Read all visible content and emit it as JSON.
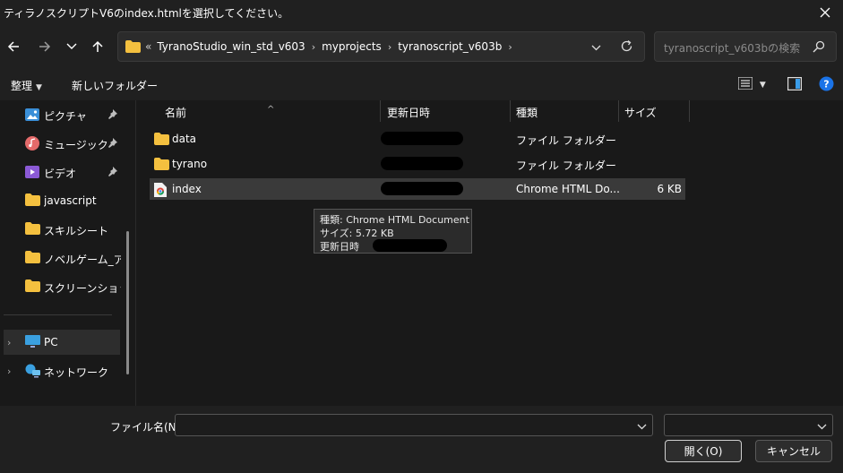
{
  "window": {
    "title": "ティラノスクリプトV6のindex.htmlを選択してください。"
  },
  "address": {
    "overflow": "«",
    "crumbs": [
      "TyranoStudio_win_std_v603",
      "myprojects",
      "tyranoscript_v603b"
    ]
  },
  "search": {
    "placeholder": "tyranoscript_v603bの検索"
  },
  "commands": {
    "organize": "整理",
    "new_folder": "新しいフォルダー"
  },
  "sidebar": {
    "items": [
      {
        "label": "ピクチャ",
        "icon": "pictures-icon",
        "pinned": true
      },
      {
        "label": "ミュージック",
        "icon": "music-icon",
        "pinned": true
      },
      {
        "label": "ビデオ",
        "icon": "video-icon",
        "pinned": true
      },
      {
        "label": "javascript",
        "icon": "folder-icon",
        "pinned": false
      },
      {
        "label": "スキルシート",
        "icon": "folder-icon",
        "pinned": false
      },
      {
        "label": "ノベルゲーム_アイラ",
        "icon": "folder-icon",
        "pinned": false
      },
      {
        "label": "スクリーンショット",
        "icon": "folder-icon",
        "pinned": false
      },
      {
        "label": "PC",
        "icon": "pc-icon",
        "pinned": false
      },
      {
        "label": "ネットワーク",
        "icon": "network-icon",
        "pinned": false
      }
    ]
  },
  "columns": {
    "name": "名前",
    "date": "更新日時",
    "type": "種類",
    "size": "サイズ"
  },
  "files": [
    {
      "name": "data",
      "type": "ファイル フォルダー",
      "size": "",
      "icon": "folder-icon"
    },
    {
      "name": "tyrano",
      "type": "ファイル フォルダー",
      "size": "",
      "icon": "folder-icon"
    },
    {
      "name": "index",
      "type": "Chrome HTML Do...",
      "size": "6 KB",
      "icon": "chrome-html-icon"
    }
  ],
  "tooltip": {
    "type_line": "種類: Chrome HTML Document",
    "size_line": "サイズ: 5.72 KB",
    "date_line": "更新日時"
  },
  "footer": {
    "filename_label": "ファイル名(N):",
    "filename_value": "",
    "filetype_value": "",
    "open_button": "開く(O)",
    "cancel_button": "キャンセル"
  },
  "colors": {
    "background": "#191919",
    "chrome": "#202020",
    "folder": "#f4c03f",
    "selected_row": "#3a3a3a",
    "help": "#1a73e8"
  }
}
